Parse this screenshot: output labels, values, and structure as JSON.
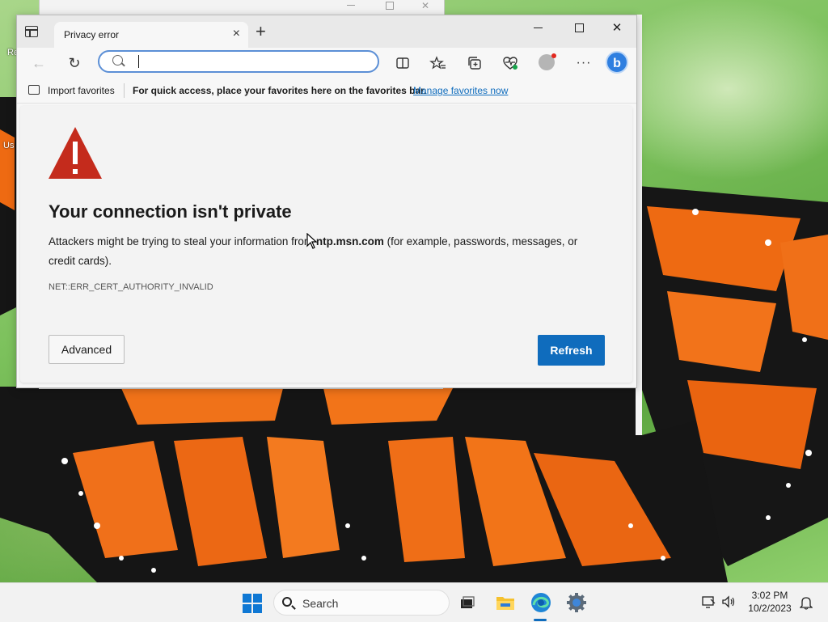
{
  "desktop": {
    "icon_labels": [
      "Re",
      "Us"
    ]
  },
  "browser": {
    "tab": {
      "title": "Privacy error",
      "close_glyph": "×"
    },
    "new_tab_glyph": "+",
    "window_controls": {
      "close_glyph": "✕"
    },
    "address": {
      "value": "",
      "placeholder": ""
    },
    "toolbar_icons": [
      "split-screen-icon",
      "favorites-icon",
      "collections-icon",
      "browser-essentials-icon",
      "profile-avatar",
      "more-icon",
      "copilot-icon"
    ],
    "favorites_bar": {
      "import_label": "Import favorites",
      "message": "For quick access, place your favorites here on the favorites bar.",
      "link_label": "Manage favorites now"
    }
  },
  "error_page": {
    "title": "Your connection isn't private",
    "desc_before": "Attackers might be trying to steal your information from ",
    "host": "ntp.msn.com",
    "desc_after": " (for example, passwords, messages, or credit cards).",
    "code": "NET::ERR_CERT_AUTHORITY_INVALID",
    "advanced_label": "Advanced",
    "refresh_label": "Refresh"
  },
  "taskbar": {
    "search_label": "Search",
    "apps": [
      "start-icon",
      "task-view-icon",
      "file-explorer-icon",
      "edge-icon",
      "settings-icon"
    ],
    "active_app": "edge-icon",
    "time": "3:02 PM",
    "date": "10/2/2023"
  },
  "colors": {
    "accent": "#0f6cbd",
    "warning_red": "#c42b1c",
    "windows_blue": "#0f78d4"
  }
}
